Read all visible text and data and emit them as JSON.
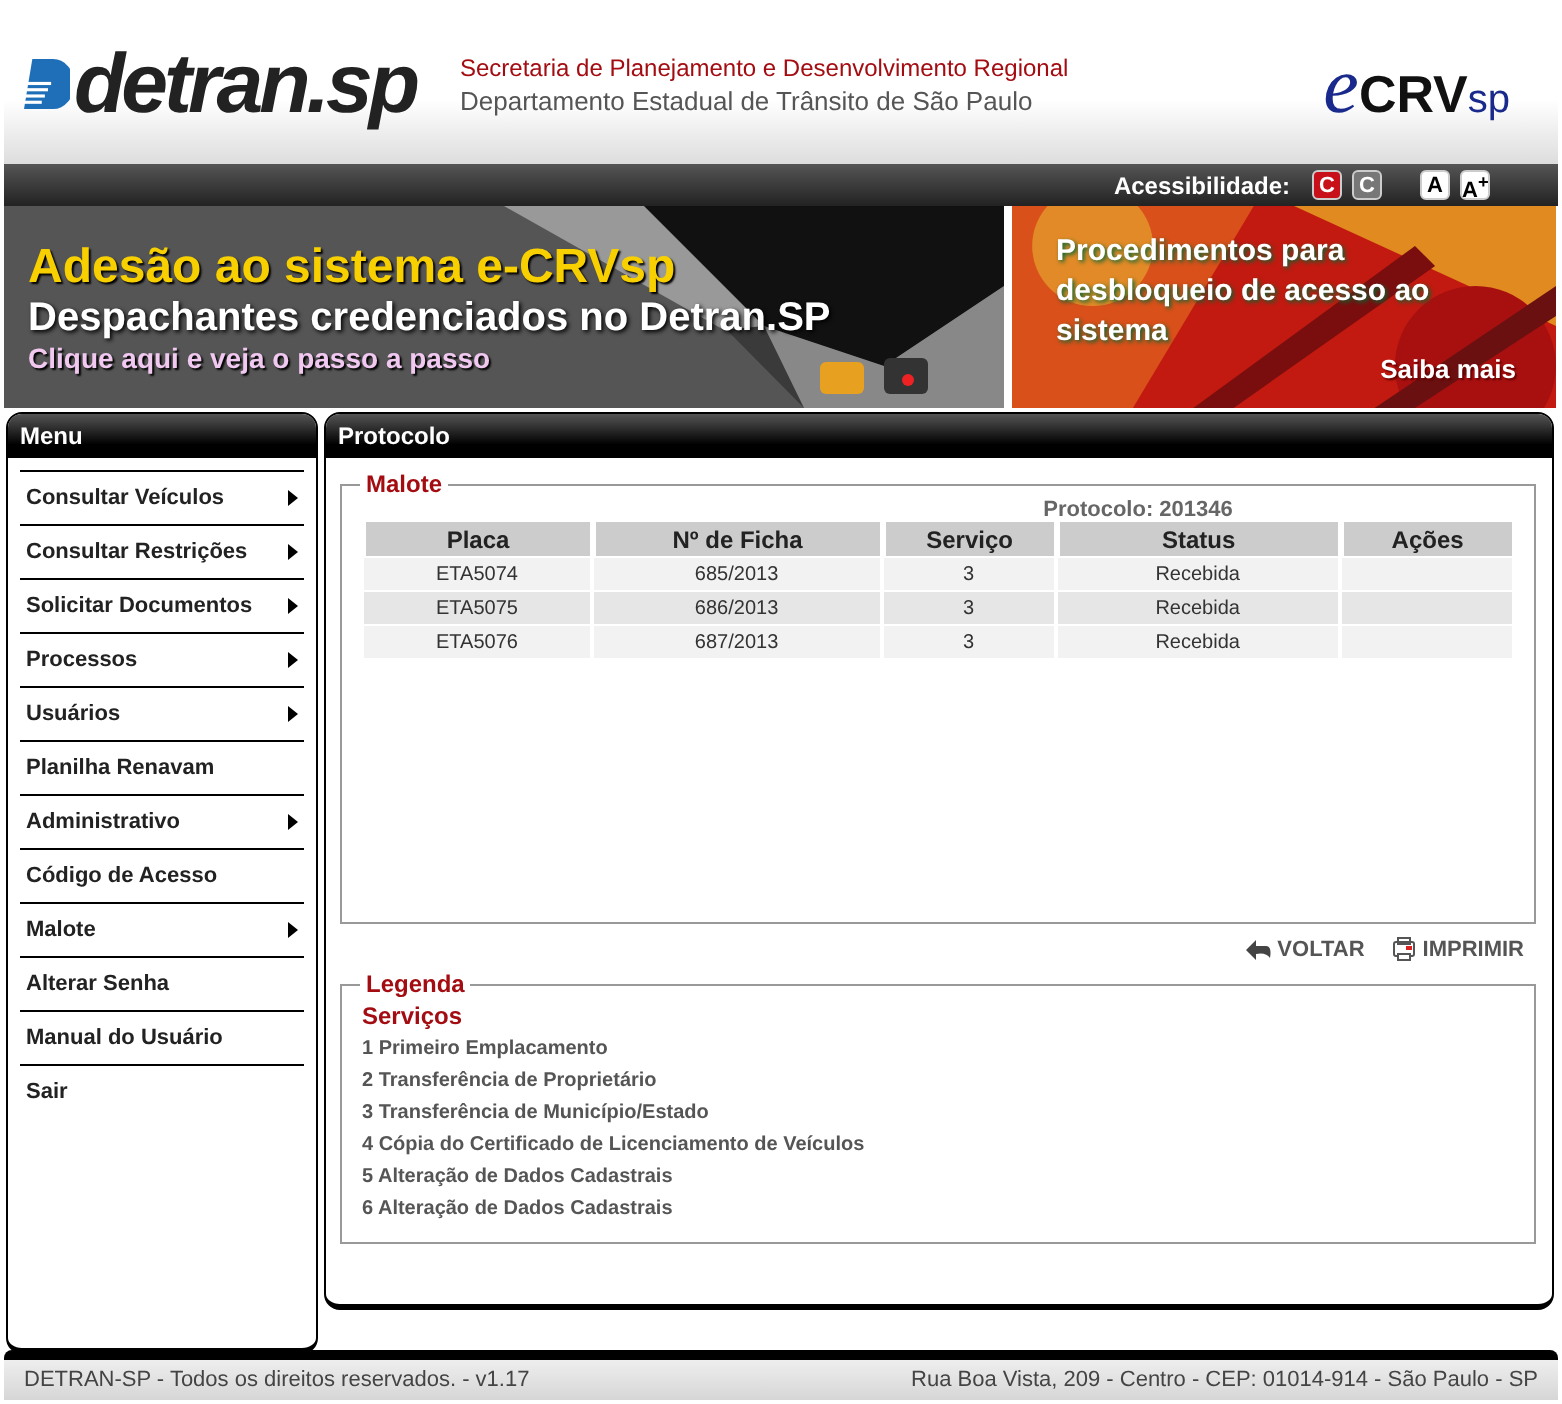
{
  "header": {
    "logo": "detran.sp",
    "secretaria": "Secretaria de Planejamento e Desenvolvimento Regional",
    "departamento": "Departamento Estadual de Trânsito de São Paulo",
    "system_logo": {
      "prefix": "e",
      "name": "CRV",
      "suffix": "sp"
    }
  },
  "accessibility": {
    "label": "Acessibilidade:",
    "buttons": [
      {
        "label": "C",
        "kind": "contrast-high"
      },
      {
        "label": "C",
        "kind": "contrast-normal"
      },
      {
        "label": "A",
        "kind": "font"
      },
      {
        "label": "A$^{+}$",
        "kind": "font"
      }
    ]
  },
  "banners": [
    {
      "title": "Adesão ao sistema e-CRVsp",
      "subtitle": "Despachantes credenciados no Detran.SP",
      "link": "Clique aqui e veja o passo a passo"
    },
    {
      "title": "Procedimentos para desbloqueio de acesso ao sistema",
      "link": "Saiba mais"
    }
  ],
  "sidebar": {
    "title": "Menu",
    "items": [
      {
        "label": "Consultar Veículos",
        "submenu": true
      },
      {
        "label": "Consultar Restrições",
        "submenu": true
      },
      {
        "label": "Solicitar Documentos",
        "submenu": true
      },
      {
        "label": "Processos",
        "submenu": true
      },
      {
        "label": "Usuários",
        "submenu": true
      },
      {
        "label": "Planilha Renavam",
        "submenu": false
      },
      {
        "label": "Administrativo",
        "submenu": true
      },
      {
        "label": "Código de Acesso",
        "submenu": false
      },
      {
        "label": "Malote",
        "submenu": true
      },
      {
        "label": "Alterar Senha",
        "submenu": false
      },
      {
        "label": "Manual do Usuário",
        "submenu": false
      },
      {
        "label": "Sair",
        "submenu": false
      }
    ]
  },
  "panel": {
    "title": "Protocolo",
    "malote": {
      "legend": "Malote",
      "protocolo": "Protocolo: 201346",
      "columns": [
        "Placa",
        "Nº de Ficha",
        "Serviço",
        "Status",
        "Ações"
      ],
      "rows": [
        [
          "ETA5074",
          "685/2013",
          "3",
          "Recebida",
          ""
        ],
        [
          "ETA5075",
          "686/2013",
          "3",
          "Recebida",
          ""
        ],
        [
          "ETA5076",
          "687/2013",
          "3",
          "Recebida",
          ""
        ]
      ]
    },
    "actions": [
      {
        "label": "VOLTAR",
        "kind": "back"
      },
      {
        "label": "IMPRIMIR",
        "kind": "print"
      }
    ],
    "legenda": {
      "legend": "Legenda",
      "heading": "Serviços",
      "items": [
        "1 Primeiro Emplacamento",
        "2 Transferência de Proprietário",
        "3 Transferência de Município/Estado",
        "4 Cópia do Certificado de Licenciamento de Veículos",
        "5 Alteração de Dados Cadastrais",
        "6 Alteração de Dados Cadastrais"
      ]
    }
  },
  "footer": {
    "left": "DETRAN-SP - Todos os direitos reservados. - v1.17",
    "right": "Rua Boa Vista, 209 - Centro - CEP: 01014-914 - São Paulo - SP"
  }
}
